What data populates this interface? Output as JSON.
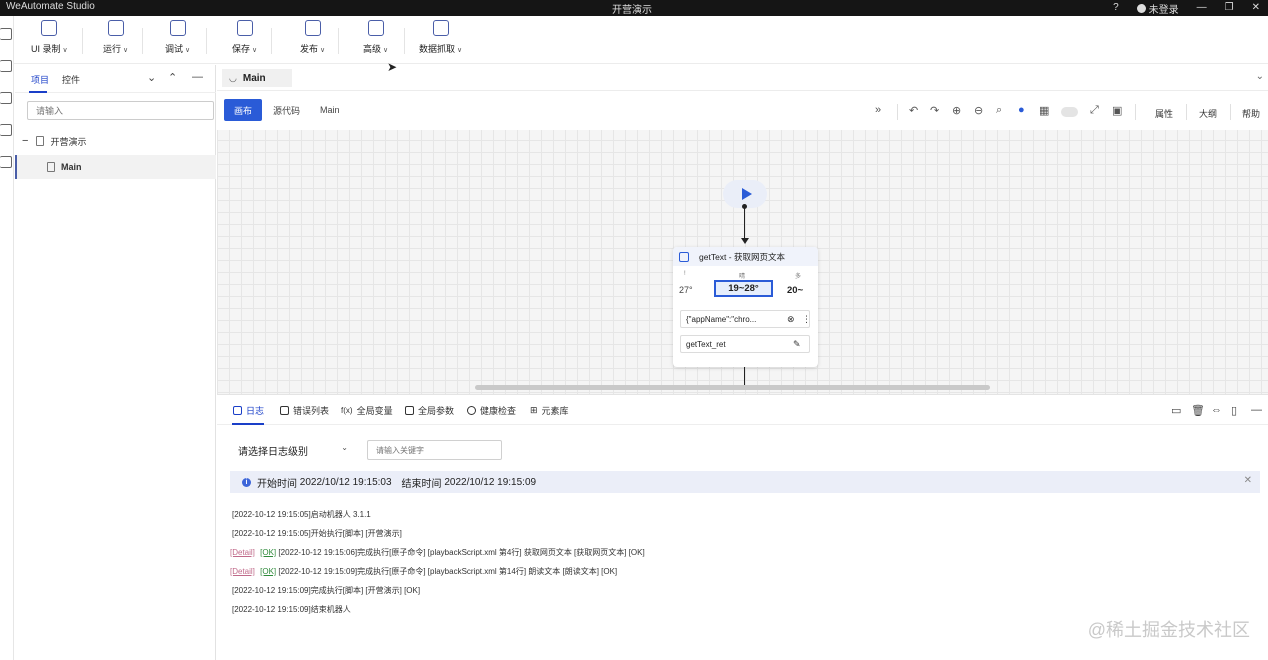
{
  "window": {
    "app_title": "WeAutomate Studio",
    "doc_title": "开营演示",
    "login_label": "未登录"
  },
  "toolbar": {
    "items": [
      {
        "label": "UI 录制",
        "icon": "video-record-icon"
      },
      {
        "label": "运行",
        "icon": "play-icon"
      },
      {
        "label": "调试",
        "icon": "bug-icon"
      },
      {
        "label": "保存",
        "icon": "save-icon"
      },
      {
        "label": "发布",
        "icon": "send-icon"
      },
      {
        "label": "高级",
        "icon": "layers-icon"
      },
      {
        "label": "数据抓取",
        "icon": "table-scrape-icon"
      }
    ]
  },
  "project_panel": {
    "tabs": [
      "项目",
      "控件"
    ],
    "search_placeholder": "请输入",
    "tree": {
      "root": "开营演示",
      "child": "Main"
    }
  },
  "editor": {
    "tab_label": "Main",
    "view_buttons": [
      "画布",
      "源代码",
      "Main"
    ],
    "right_menu": [
      "属性",
      "大纲",
      "帮助"
    ]
  },
  "flow": {
    "activity_title": "getText - 获取网页文本",
    "preview": {
      "top_left": "!",
      "top_mid": "晴",
      "top_right": "多",
      "temp_left": "27°",
      "temp_highlight": "19~28°",
      "temp_right": "20~"
    },
    "selector_value": "{\"appName\":\"chro...",
    "output_var": "getText_ret"
  },
  "log_panel": {
    "tabs": [
      "日志",
      "错误列表",
      "全局变量",
      "全局参数",
      "健康检查",
      "元素库"
    ],
    "level_select": "请选择日志级别",
    "keyword_placeholder": "请输入关键字",
    "info": {
      "start_label": "开始时间",
      "start_time": "2022/10/12 19:15:03",
      "end_label": "结束时间",
      "end_time": "2022/10/12 19:15:09"
    },
    "lines": [
      {
        "detail": "",
        "ok": "",
        "text": "[2022-10-12 19:15:05]启动机器人 3.1.1"
      },
      {
        "detail": "",
        "ok": "",
        "text": "[2022-10-12 19:15:05]开始执行[脚本] [开营演示]"
      },
      {
        "detail": "[Detail]",
        "ok": "[OK]",
        "text": "[2022-10-12 19:15:06]完成执行[原子命令] [playbackScript.xml 第4行] 获取网页文本 [获取网页文本] [OK]"
      },
      {
        "detail": "[Detail]",
        "ok": "[OK]",
        "text": "[2022-10-12 19:15:09]完成执行[原子命令] [playbackScript.xml 第14行] 朗读文本 [朗读文本] [OK]"
      },
      {
        "detail": "",
        "ok": "",
        "text": "[2022-10-12 19:15:09]完成执行[脚本] [开营演示] [OK]"
      },
      {
        "detail": "",
        "ok": "",
        "text": "[2022-10-12 19:15:09]结束机器人"
      }
    ]
  },
  "watermark": "@稀土掘金技术社区"
}
